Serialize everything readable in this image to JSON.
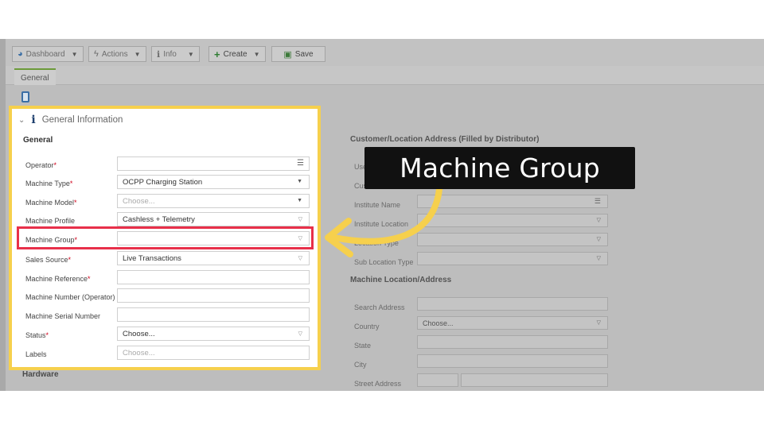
{
  "toolbar": {
    "dashboard_label": "Dashboard",
    "actions_label": "Actions",
    "info_label": "Info",
    "create_label": "Create",
    "save_label": "Save"
  },
  "tabs": [
    {
      "label": "General"
    }
  ],
  "panel": {
    "title": "General Information",
    "subheading": "General",
    "fields": [
      {
        "label": "Operator",
        "required": "*",
        "value": "",
        "placeholder": ""
      },
      {
        "label": "Machine Type",
        "required": "*",
        "value": "OCPP Charging Station"
      },
      {
        "label": "Machine Model",
        "required": "*",
        "value": "",
        "placeholder": "Choose..."
      },
      {
        "label": "Machine Profile",
        "required": "",
        "value": "Cashless + Telemetry"
      },
      {
        "label": "Machine Group",
        "required": "*",
        "value": ""
      },
      {
        "label": "Sales Source",
        "required": "*",
        "value": "Live Transactions"
      },
      {
        "label": "Machine Reference",
        "required": "*",
        "value": ""
      },
      {
        "label": "Machine Number (Operator)",
        "required": "",
        "value": ""
      },
      {
        "label": "Machine Serial Number",
        "required": "",
        "value": ""
      },
      {
        "label": "Status",
        "required": "*",
        "value": "Choose..."
      },
      {
        "label": "Labels",
        "required": "",
        "value": "",
        "placeholder": "Choose..."
      }
    ]
  },
  "hardware_heading": "Hardware",
  "right": {
    "customer_heading": "Customer/Location Address (Filled by Distributor)",
    "customer_fields": [
      {
        "label": "Use"
      },
      {
        "label": "Cus"
      },
      {
        "label": "Institute Name"
      },
      {
        "label": "Institute Location"
      },
      {
        "label": "Location Type"
      },
      {
        "label": "Sub Location Type"
      }
    ],
    "machine_location_heading": "Machine Location/Address",
    "location_fields": [
      {
        "label": "Search Address",
        "value": ""
      },
      {
        "label": "Country",
        "value": "Choose..."
      },
      {
        "label": "State",
        "value": ""
      },
      {
        "label": "City",
        "value": ""
      },
      {
        "label": "Street Address",
        "value": ""
      }
    ]
  },
  "callout": {
    "text": "Machine Group"
  },
  "colors": {
    "highlight_frame": "#f6d04d",
    "field_highlight": "#e8304a",
    "arrow": "#f6d04d",
    "required_mark": "#d0021b"
  }
}
